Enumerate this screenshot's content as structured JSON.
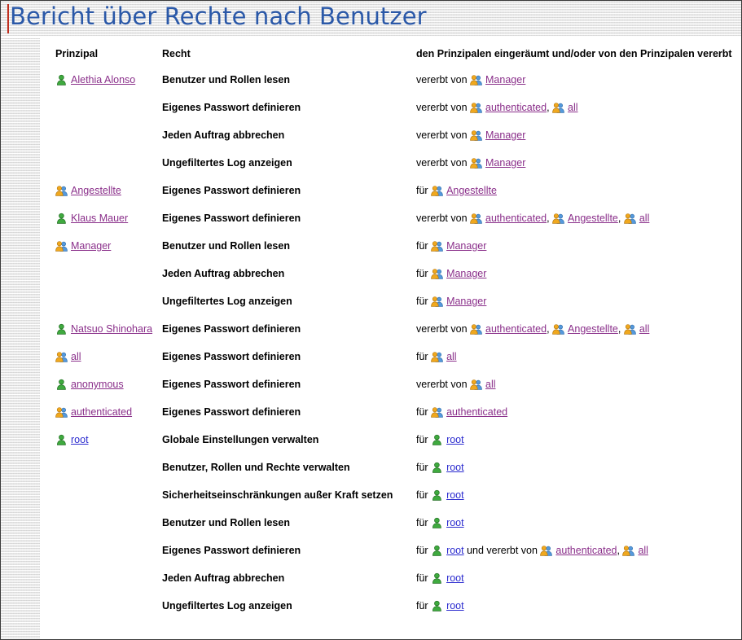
{
  "window": {
    "title": "Bericht über Rechte nach Benutzer"
  },
  "colors": {
    "title_text": "#2a58a8",
    "title_accent": "#c03020",
    "link_visited": "#8a2f8a",
    "link_unvisited": "#2b2bcf",
    "user_icon": "#3faa3f",
    "group_icon_front": "#f0a81e",
    "group_icon_back": "#5599dd",
    "page_background": "#ffffff",
    "gutter_background": "#f2f2f2",
    "border": "#3a3a3a"
  },
  "table": {
    "headers": {
      "principal": "Prinzipal",
      "right": "Recht",
      "granted": "den Prinzipalen eingeräumt und/oder von den Prinzipalen vererbt"
    },
    "rows": [
      {
        "principal": {
          "label": "Alethia Alonso",
          "icon": "user-icon",
          "link": true,
          "visited": true
        },
        "right": "Benutzer und Rollen lesen",
        "granted": {
          "lead": "vererbt von ",
          "items": [
            {
              "label": "Manager",
              "icon": "group-icon",
              "visited": true
            }
          ],
          "tail": ""
        }
      },
      {
        "principal": null,
        "right": "Eigenes Passwort definieren",
        "granted": {
          "lead": "vererbt von ",
          "items": [
            {
              "label": "authenticated",
              "icon": "group-icon",
              "visited": true
            },
            {
              "label": "all",
              "icon": "group-icon",
              "visited": true
            }
          ],
          "tail": ""
        }
      },
      {
        "principal": null,
        "right": "Jeden Auftrag abbrechen",
        "granted": {
          "lead": "vererbt von ",
          "items": [
            {
              "label": "Manager",
              "icon": "group-icon",
              "visited": true
            }
          ],
          "tail": ""
        }
      },
      {
        "principal": null,
        "right": "Ungefiltertes Log anzeigen",
        "granted": {
          "lead": "vererbt von ",
          "items": [
            {
              "label": "Manager",
              "icon": "group-icon",
              "visited": true
            }
          ],
          "tail": ""
        }
      },
      {
        "principal": {
          "label": "Angestellte",
          "icon": "group-icon",
          "link": true,
          "visited": true
        },
        "right": "Eigenes Passwort definieren",
        "granted": {
          "lead": "für ",
          "items": [
            {
              "label": "Angestellte",
              "icon": "group-icon",
              "visited": true
            }
          ],
          "tail": ""
        }
      },
      {
        "principal": {
          "label": "Klaus Mauer",
          "icon": "user-icon",
          "link": true,
          "visited": true
        },
        "right": "Eigenes Passwort definieren",
        "granted": {
          "lead": "vererbt von ",
          "items": [
            {
              "label": "authenticated",
              "icon": "group-icon",
              "visited": true
            },
            {
              "label": "Angestellte",
              "icon": "group-icon",
              "visited": true
            },
            {
              "label": "all",
              "icon": "group-icon",
              "visited": true
            }
          ],
          "tail": ""
        }
      },
      {
        "principal": {
          "label": "Manager",
          "icon": "group-icon",
          "link": true,
          "visited": true
        },
        "right": "Benutzer und Rollen lesen",
        "granted": {
          "lead": "für ",
          "items": [
            {
              "label": "Manager",
              "icon": "group-icon",
              "visited": true
            }
          ],
          "tail": ""
        }
      },
      {
        "principal": null,
        "right": "Jeden Auftrag abbrechen",
        "granted": {
          "lead": "für ",
          "items": [
            {
              "label": "Manager",
              "icon": "group-icon",
              "visited": true
            }
          ],
          "tail": ""
        }
      },
      {
        "principal": null,
        "right": "Ungefiltertes Log anzeigen",
        "granted": {
          "lead": "für ",
          "items": [
            {
              "label": "Manager",
              "icon": "group-icon",
              "visited": true
            }
          ],
          "tail": ""
        }
      },
      {
        "principal": {
          "label": "Natsuo Shinohara",
          "icon": "user-icon",
          "link": true,
          "visited": true
        },
        "right": "Eigenes Passwort definieren",
        "granted": {
          "lead": "vererbt von ",
          "items": [
            {
              "label": "authenticated",
              "icon": "group-icon",
              "visited": true
            },
            {
              "label": "Angestellte",
              "icon": "group-icon",
              "visited": true
            },
            {
              "label": "all",
              "icon": "group-icon",
              "visited": true
            }
          ],
          "tail": ""
        }
      },
      {
        "principal": {
          "label": "all",
          "icon": "group-icon",
          "link": true,
          "visited": true
        },
        "right": "Eigenes Passwort definieren",
        "granted": {
          "lead": "für ",
          "items": [
            {
              "label": "all",
              "icon": "group-icon",
              "visited": true
            }
          ],
          "tail": ""
        }
      },
      {
        "principal": {
          "label": "anonymous",
          "icon": "user-icon",
          "link": true,
          "visited": true
        },
        "right": "Eigenes Passwort definieren",
        "granted": {
          "lead": "vererbt von ",
          "items": [
            {
              "label": "all",
              "icon": "group-icon",
              "visited": true
            }
          ],
          "tail": ""
        }
      },
      {
        "principal": {
          "label": "authenticated",
          "icon": "group-icon",
          "link": true,
          "visited": true
        },
        "right": "Eigenes Passwort definieren",
        "granted": {
          "lead": "für ",
          "items": [
            {
              "label": "authenticated",
              "icon": "group-icon",
              "visited": true
            }
          ],
          "tail": ""
        }
      },
      {
        "principal": {
          "label": "root",
          "icon": "user-icon",
          "link": true,
          "visited": false
        },
        "right": "Globale Einstellungen verwalten",
        "granted": {
          "lead": "für ",
          "items": [
            {
              "label": "root",
              "icon": "user-icon",
              "visited": false
            }
          ],
          "tail": ""
        }
      },
      {
        "principal": null,
        "right": "Benutzer, Rollen und Rechte verwalten",
        "granted": {
          "lead": "für ",
          "items": [
            {
              "label": "root",
              "icon": "user-icon",
              "visited": false
            }
          ],
          "tail": ""
        }
      },
      {
        "principal": null,
        "right": "Sicherheitseinschränkungen außer Kraft setzen",
        "granted": {
          "lead": "für ",
          "items": [
            {
              "label": "root",
              "icon": "user-icon",
              "visited": false
            }
          ],
          "tail": ""
        }
      },
      {
        "principal": null,
        "right": "Benutzer und Rollen lesen",
        "granted": {
          "lead": "für ",
          "items": [
            {
              "label": "root",
              "icon": "user-icon",
              "visited": false
            }
          ],
          "tail": ""
        }
      },
      {
        "principal": null,
        "right": "Eigenes Passwort definieren",
        "granted": {
          "lead": "für ",
          "items": [
            {
              "label": "root",
              "icon": "user-icon",
              "visited": false,
              "after": " und vererbt von "
            },
            {
              "label": "authenticated",
              "icon": "group-icon",
              "visited": true
            },
            {
              "label": "all",
              "icon": "group-icon",
              "visited": true
            }
          ],
          "tail": ""
        }
      },
      {
        "principal": null,
        "right": "Jeden Auftrag abbrechen",
        "granted": {
          "lead": "für ",
          "items": [
            {
              "label": "root",
              "icon": "user-icon",
              "visited": false
            }
          ],
          "tail": ""
        }
      },
      {
        "principal": null,
        "right": "Ungefiltertes Log anzeigen",
        "granted": {
          "lead": "für ",
          "items": [
            {
              "label": "root",
              "icon": "user-icon",
              "visited": false
            }
          ],
          "tail": ""
        }
      }
    ]
  }
}
